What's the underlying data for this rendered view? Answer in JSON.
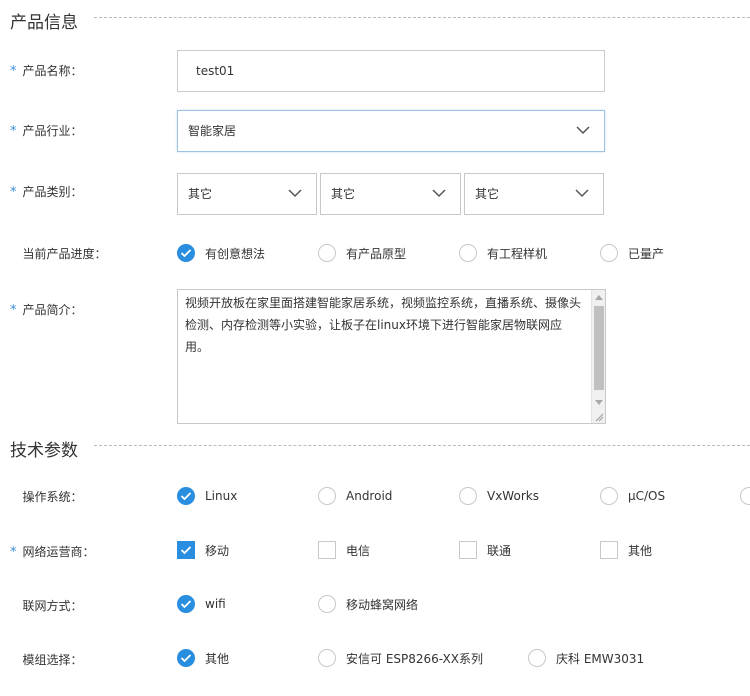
{
  "sections": {
    "product_info": "产品信息",
    "tech_params": "技术参数"
  },
  "product_name": {
    "label": "产品名称：",
    "value": "test01"
  },
  "industry": {
    "label": "产品行业：",
    "value": "智能家居"
  },
  "category": {
    "label": "产品类别：",
    "values": [
      "其它",
      "其它",
      "其它"
    ]
  },
  "progress": {
    "label": "当前产品进度：",
    "options": [
      "有创意想法",
      "有产品原型",
      "有工程样机",
      "已量产"
    ],
    "selected": "有创意想法"
  },
  "description": {
    "label": "产品简介：",
    "text": "视频开放板在家里面搭建智能家居系统，视频监控系统，直播系统、摄像头检测、内存检测等小实验，让板子在linux环境下进行智能家居物联网应用。"
  },
  "os": {
    "label": "操作系统：",
    "options": [
      "Linux",
      "Android",
      "VxWorks",
      "μC/OS"
    ],
    "selected": "Linux"
  },
  "carrier": {
    "label": "网络运营商：",
    "options": [
      "移动",
      "电信",
      "联通",
      "其他"
    ],
    "checked": [
      "移动"
    ]
  },
  "network": {
    "label": "联网方式：",
    "options": [
      "wifi",
      "移动蜂窝网络"
    ],
    "selected": "wifi"
  },
  "module": {
    "label": "模组选择：",
    "options": [
      "其他",
      "安信可 ESP8266-XX系列",
      "庆科 EMW3031"
    ],
    "selected": "其他"
  },
  "colors": {
    "accent": "#2a8ee0",
    "required_star": "#3b8fd8"
  },
  "icons": {
    "dropdown": "chevron-down-icon",
    "check": "check-icon"
  }
}
